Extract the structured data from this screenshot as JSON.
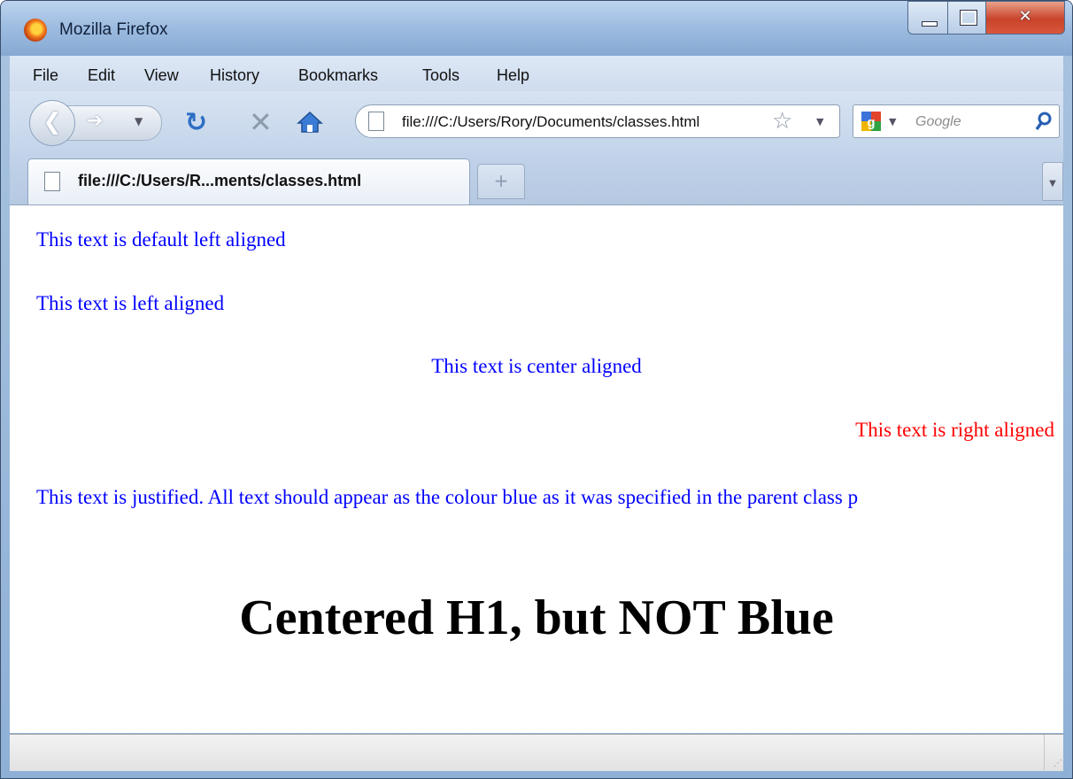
{
  "window": {
    "title": "Mozilla Firefox",
    "minimize_icon": "minimize-icon",
    "maximize_icon": "maximize-icon",
    "close_icon": "close-icon"
  },
  "menu": {
    "items": [
      "File",
      "Edit",
      "View",
      "History",
      "Bookmarks",
      "Tools",
      "Help"
    ]
  },
  "nav": {
    "url": "file:///C:/Users/Rory/Documents/classes.html",
    "search_placeholder": "Google",
    "icons": [
      "back-arrow-icon",
      "forward-arrow-icon",
      "reload-icon",
      "stop-icon",
      "home-icon",
      "page-icon",
      "bookmark-star-icon",
      "google-icon",
      "search-icon"
    ]
  },
  "tab": {
    "title": "file:///C:/Users/R...ments/classes.html",
    "new_tab": "+"
  },
  "page": {
    "p_default": "This text is default left aligned",
    "p_left": "This text is left aligned",
    "p_center": "This text is center aligned",
    "p_right": "This text is right aligned",
    "p_justify": "This text is justified. All text should appear as the colour blue as it was specified in the parent class p",
    "h1": "Centered H1, but NOT Blue"
  },
  "colors": {
    "paragraph": "#0000ff",
    "right_paragraph": "#ff0000",
    "heading": "#000000"
  }
}
